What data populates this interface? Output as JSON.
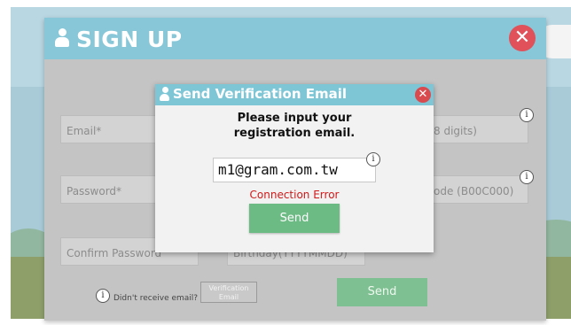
{
  "header": {
    "title": "SIGN UP",
    "close_label": "✕"
  },
  "form": {
    "email_placeholder": "Email*",
    "password_placeholder": "Password*",
    "confirm_password_placeholder": "Confirm Password",
    "right_field_1_text": "8 digits)",
    "right_field_2_text": "ode (B00C000)",
    "birthday_placeholder": "Birthday(YYYYMMDD)",
    "info_glyph": "i",
    "didnt_receive_label": "Didn't receive email?",
    "verification_email_label": "Verification Email",
    "send_label": "Send"
  },
  "modal": {
    "title": "Send Verification Email",
    "close_label": "✕",
    "prompt_line1": "Please input your",
    "prompt_line2": "registration email.",
    "email_value": "m1@gram.com.tw",
    "info_glyph": "i",
    "error_text": "Connection Error",
    "send_label": "Send"
  },
  "colors": {
    "header_blue": "#87c7d8",
    "close_red": "#e0515a",
    "send_green": "#6cbb84",
    "error_red": "#d01919"
  }
}
